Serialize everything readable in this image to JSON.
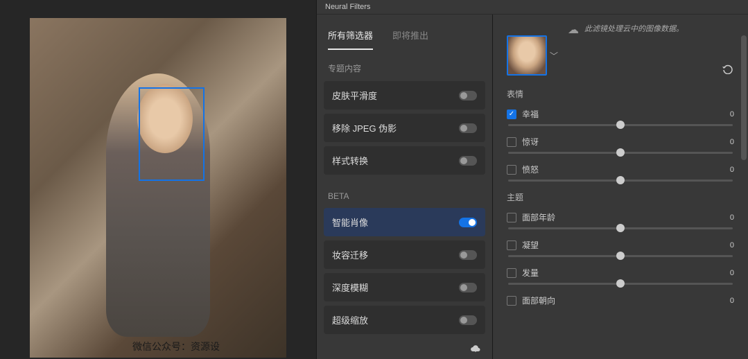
{
  "panel_title": "Neural Filters",
  "watermark": "微信公众号：资源设",
  "tabs": {
    "all": "所有筛选器",
    "upcoming": "即将推出"
  },
  "sections": {
    "featured": "专题内容",
    "beta": "BETA"
  },
  "filters": {
    "skin": {
      "label": "皮肤平滑度",
      "on": false
    },
    "jpeg": {
      "label": "移除 JPEG 伪影",
      "on": false
    },
    "style": {
      "label": "样式转换",
      "on": false
    },
    "portrait": {
      "label": "智能肖像",
      "on": true
    },
    "makeup": {
      "label": "妆容迁移",
      "on": false
    },
    "depth": {
      "label": "深度模糊",
      "on": false
    },
    "zoom": {
      "label": "超级缩放",
      "on": false
    }
  },
  "cloud_msg": "此滤镜处理云中的图像数据。",
  "groups": {
    "expression": "表情",
    "subject": "主题"
  },
  "sliders": {
    "happy": {
      "label": "幸福",
      "value": "0",
      "checked": true,
      "pos": 50
    },
    "surprise": {
      "label": "惊讶",
      "value": "0",
      "checked": false,
      "pos": 50
    },
    "anger": {
      "label": "愤怒",
      "value": "0",
      "checked": false,
      "pos": 50
    },
    "age": {
      "label": "面部年龄",
      "value": "0",
      "checked": false,
      "pos": 50
    },
    "gaze": {
      "label": "凝望",
      "value": "0",
      "checked": false,
      "pos": 50
    },
    "hair": {
      "label": "发量",
      "value": "0",
      "checked": false,
      "pos": 50
    },
    "direction": {
      "label": "面部朝向",
      "value": "0",
      "checked": false,
      "pos": 50
    }
  }
}
